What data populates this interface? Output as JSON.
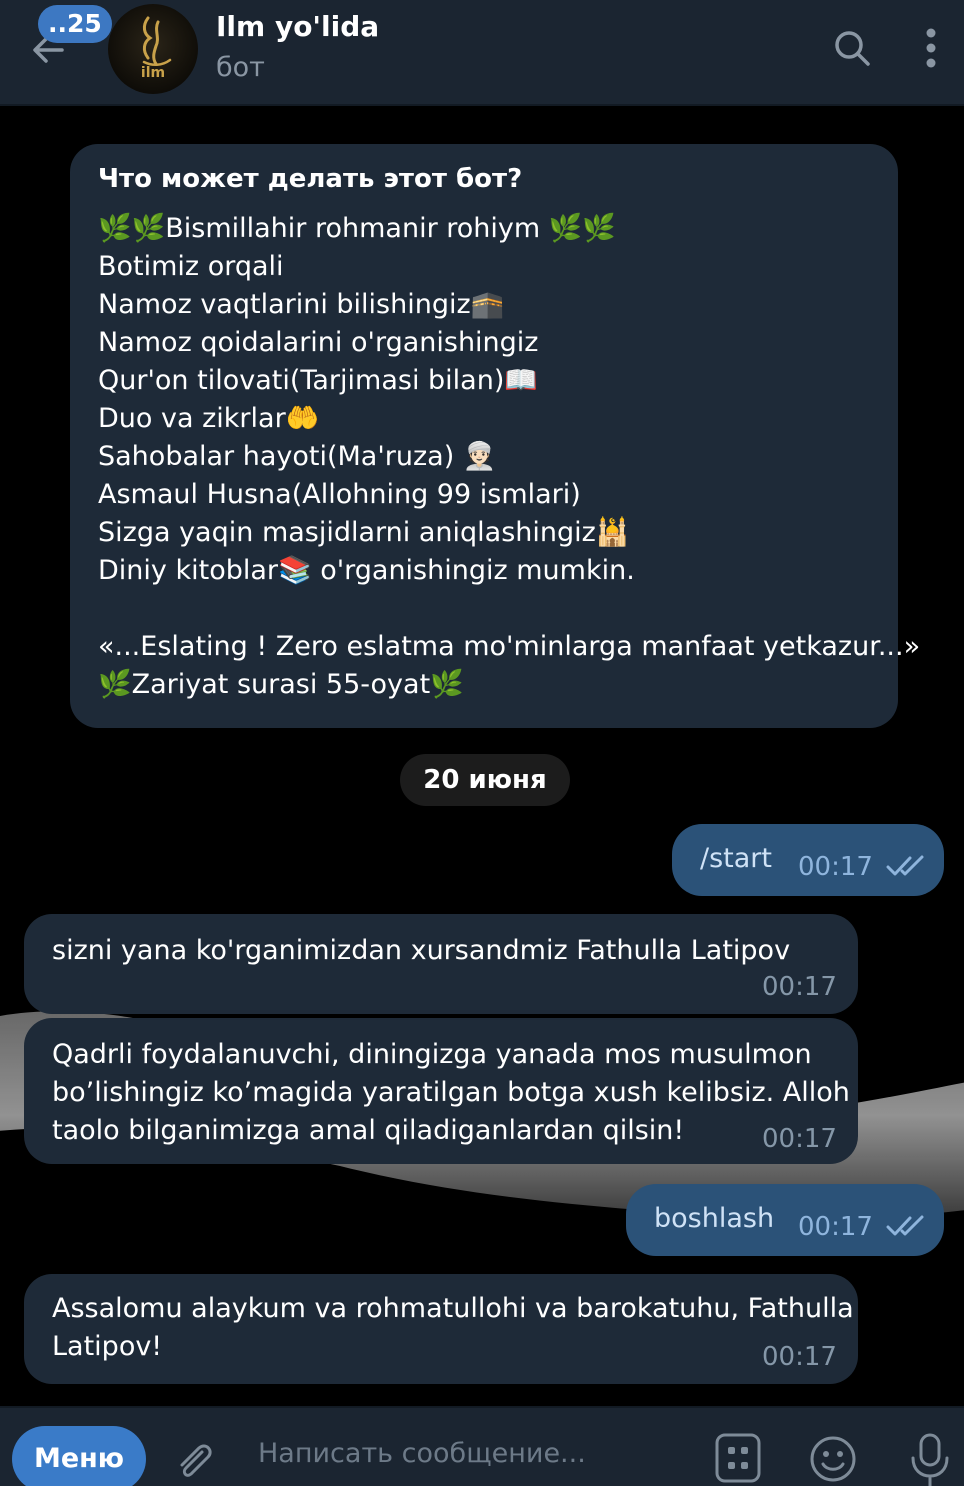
{
  "header": {
    "unread_count": "..25",
    "title": "Ilm yo'lida",
    "subtitle": "бот",
    "avatar_text": "ilm"
  },
  "intro": {
    "title": "Что может делать этот бот?",
    "lines": [
      "🌿🌿Bismillahir rohmanir rohiym 🌿🌿",
      "Botimiz orqali",
      "Namoz vaqtlarini bilishingiz🕋",
      "Namoz qoidalarini o'rganishingiz",
      "Qur'on tilovati(Tarjimasi bilan)📖",
      "Duo va zikrlar🤲",
      "Sahobalar hayoti(Ma'ruza) 👳🏻",
      "Asmaul Husna(Allohning 99 ismlari)",
      "Sizga yaqin masjidlarni aniqlashingiz🕌",
      "Diniy kitoblar📚  o'rganishingiz mumkin.",
      "",
      "«...Eslating ! Zero eslatma mo'minlarga manfaat yetkazur...»",
      "🌿Zariyat surasi 55-oyat🌿"
    ]
  },
  "date_separator": "20 июня",
  "messages": [
    {
      "direction": "out",
      "text": "/start",
      "time": "00:17",
      "status": "read"
    },
    {
      "direction": "in",
      "text": "sizni yana ko'rganimizdan xursandmiz Fathulla Latipov",
      "time": "00:17"
    },
    {
      "direction": "in",
      "lines": [
        "Qadrli foydalanuvchi, diningizga yanada mos musulmon",
        "bo’lishingiz ko’magida yaratilgan botga xush kelibsiz. Alloh",
        "taolo bilganimizga amal qiladiganlardan qilsin!"
      ],
      "time": "00:17"
    },
    {
      "direction": "out",
      "text": "boshlash",
      "time": "00:17",
      "status": "read"
    },
    {
      "direction": "in",
      "lines": [
        "Assalomu alaykum va rohmatullohi va barokatuhu, Fathulla",
        "Latipov!"
      ],
      "time": "00:17"
    }
  ],
  "input": {
    "menu_label": "Меню",
    "placeholder": "Написать сообщение..."
  },
  "colors": {
    "header_bg": "#1b2531",
    "incoming_bubble": "#1e2a38",
    "outgoing_bubble": "#2b5278",
    "accent": "#3a7bc8"
  }
}
